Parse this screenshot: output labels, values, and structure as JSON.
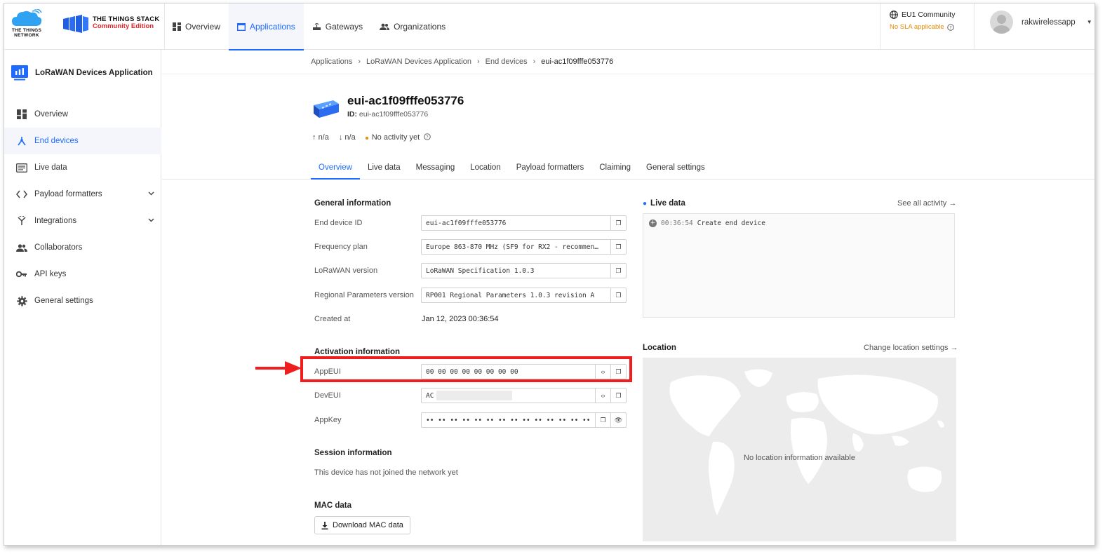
{
  "header": {
    "ttn_logo_line1": "THE THINGS",
    "ttn_logo_line2": "NETWORK",
    "stack_title": "THE THINGS STACK",
    "stack_edition": "Community Edition",
    "nav": [
      {
        "label": "Overview"
      },
      {
        "label": "Applications"
      },
      {
        "label": "Gateways"
      },
      {
        "label": "Organizations"
      }
    ],
    "cluster": "EU1 Community",
    "sla": "No SLA applicable",
    "username": "rakwirelessapp"
  },
  "sidebar": {
    "app_name": "LoRaWAN Devices Application",
    "items": [
      {
        "label": "Overview"
      },
      {
        "label": "End devices"
      },
      {
        "label": "Live data"
      },
      {
        "label": "Payload formatters"
      },
      {
        "label": "Integrations"
      },
      {
        "label": "Collaborators"
      },
      {
        "label": "API keys"
      },
      {
        "label": "General settings"
      }
    ]
  },
  "breadcrumb": {
    "items": [
      "Applications",
      "LoRaWAN Devices Application",
      "End devices",
      "eui-ac1f09fffe053776"
    ]
  },
  "device": {
    "name": "eui-ac1f09fffe053776",
    "id_label": "ID:",
    "id_value": "eui-ac1f09fffe053776",
    "uplink": "n/a",
    "downlink": "n/a",
    "activity": "No activity yet"
  },
  "tabs": [
    "Overview",
    "Live data",
    "Messaging",
    "Location",
    "Payload formatters",
    "Claiming",
    "General settings"
  ],
  "general": {
    "title": "General information",
    "end_device_id_label": "End device ID",
    "end_device_id": "eui-ac1f09fffe053776",
    "frequency_plan_label": "Frequency plan",
    "frequency_plan": "Europe 863-870 MHz (SF9 for RX2 - recommen…",
    "lorawan_version_label": "LoRaWAN version",
    "lorawan_version": "LoRaWAN Specification 1.0.3",
    "regional_label": "Regional Parameters version",
    "regional": "RP001 Regional Parameters 1.0.3 revision A",
    "created_label": "Created at",
    "created": "Jan 12, 2023 00:36:54"
  },
  "activation": {
    "title": "Activation information",
    "appeui_label": "AppEUI",
    "appeui": "00 00 00 00 00 00 00 00",
    "deveui_label": "DevEUI",
    "deveui_prefix": "AC",
    "appkey_label": "AppKey",
    "appkey": "•• •• •• •• •• •• •• •• •• •• •• •• •• •• •• ••"
  },
  "session": {
    "title": "Session information",
    "text": "This device has not joined the network yet"
  },
  "mac": {
    "title": "MAC data",
    "button": "Download MAC data"
  },
  "live": {
    "title": "Live data",
    "see_all": "See all activity →",
    "event_time": "00:36:54",
    "event_text": "Create end device"
  },
  "location": {
    "title": "Location",
    "change": "Change location settings →",
    "empty": "No location information available"
  },
  "colors": {
    "accent": "#1f6bff",
    "highlight": "#ef1d1d",
    "warning": "#e58a00"
  }
}
